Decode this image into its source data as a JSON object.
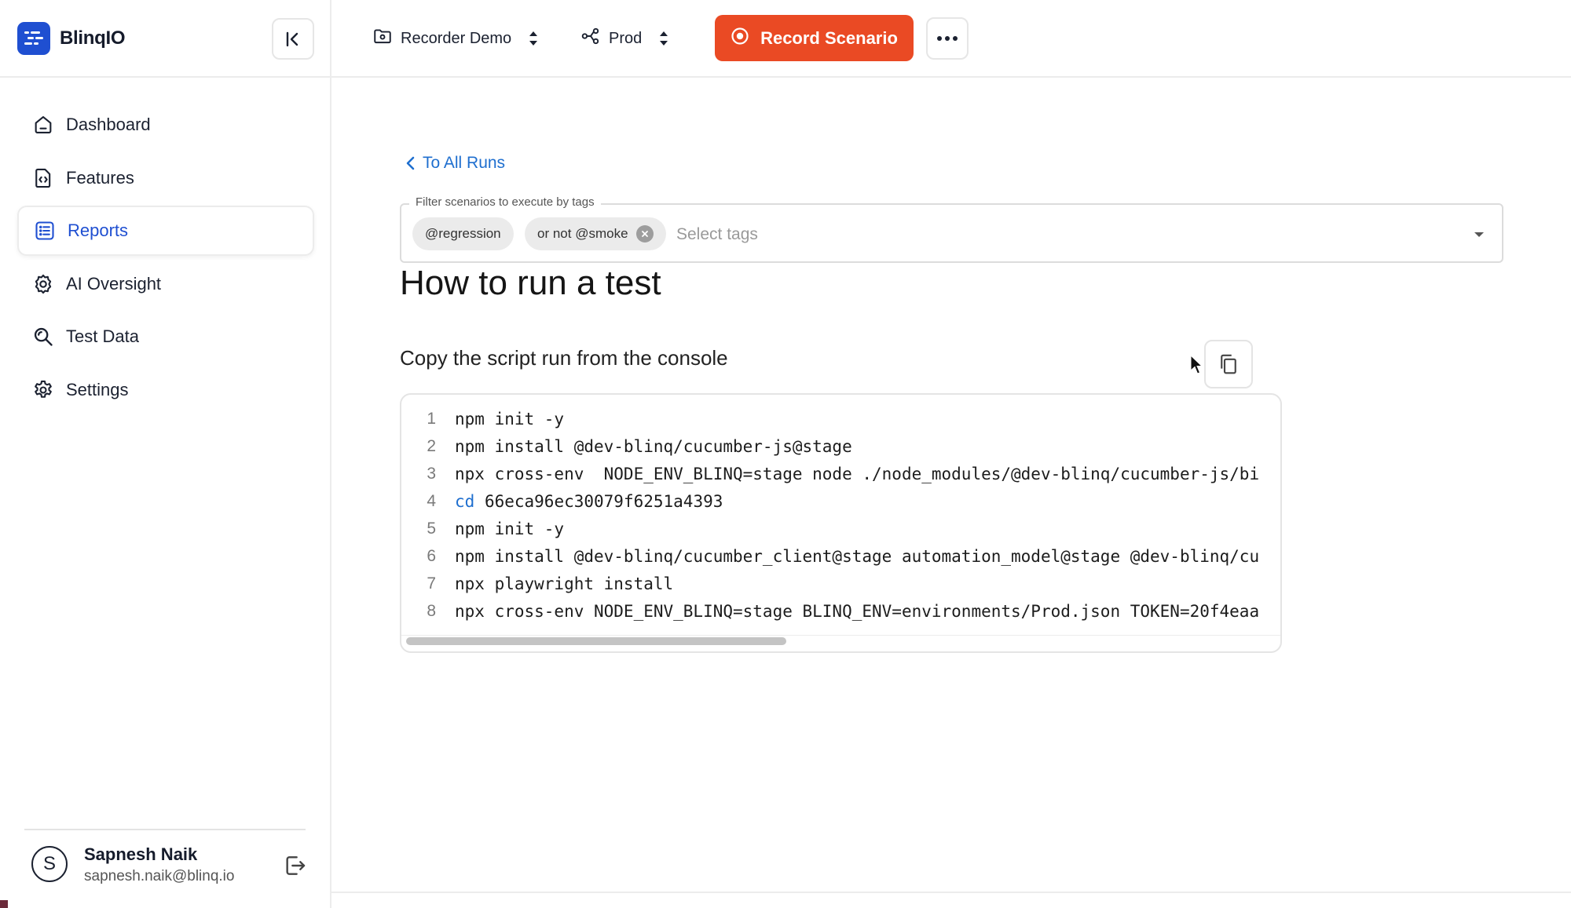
{
  "brand": {
    "name": "BlinqIO",
    "color": "#1f4fd1"
  },
  "sidebar": {
    "items": [
      {
        "label": "Dashboard",
        "icon": "home-icon"
      },
      {
        "label": "Features",
        "icon": "file-code-icon"
      },
      {
        "label": "Reports",
        "icon": "list-icon",
        "active": true
      },
      {
        "label": "AI Oversight",
        "icon": "gear-eye-icon"
      },
      {
        "label": "Test Data",
        "icon": "search-data-icon"
      },
      {
        "label": "Settings",
        "icon": "gear-icon"
      }
    ],
    "user": {
      "initial": "S",
      "name": "Sapnesh Naik",
      "email": "sapnesh.naik@blinq.io"
    }
  },
  "topbar": {
    "project": "Recorder Demo",
    "environment": "Prod",
    "record_label": "Record Scenario",
    "record_color": "#ea4a24"
  },
  "main": {
    "back_label": "To All Runs",
    "tag_filter": {
      "legend": "Filter scenarios to execute by tags",
      "chips": [
        "@regression",
        "or not @smoke"
      ],
      "placeholder": "Select tags"
    },
    "heading": "How to run a test",
    "subheading": "Copy the script run from the console",
    "code": [
      {
        "n": "1",
        "text": "npm init -y"
      },
      {
        "n": "2",
        "text": "npm install @dev-blinq/cucumber-js@stage"
      },
      {
        "n": "3",
        "text": "npx cross-env  NODE_ENV_BLINQ=stage node ./node_modules/@dev-blinq/cucumber-js/bi"
      },
      {
        "n": "4",
        "kw": "cd",
        "text": " 66eca96ec30079f6251a4393"
      },
      {
        "n": "5",
        "text": "npm init -y"
      },
      {
        "n": "6",
        "text": "npm install @dev-blinq/cucumber_client@stage automation_model@stage @dev-blinq/cu"
      },
      {
        "n": "7",
        "text": "npx playwright install"
      },
      {
        "n": "8",
        "text": "npx cross-env NODE_ENV_BLINQ=stage BLINQ_ENV=environments/Prod.json TOKEN=20f4eaa"
      }
    ]
  }
}
